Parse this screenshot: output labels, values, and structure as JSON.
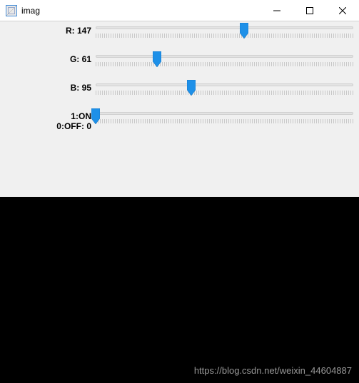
{
  "window": {
    "title": "imag"
  },
  "trackbars": {
    "max": 255,
    "r": {
      "name": "R",
      "value": 147
    },
    "g": {
      "name": "G",
      "value": 61
    },
    "b": {
      "name": "B",
      "value": 95
    },
    "switch": {
      "name": "1:ON\n0:OFF",
      "value": 0,
      "max": 1
    }
  },
  "watermark": "https://blog.csdn.net/weixin_44604887"
}
